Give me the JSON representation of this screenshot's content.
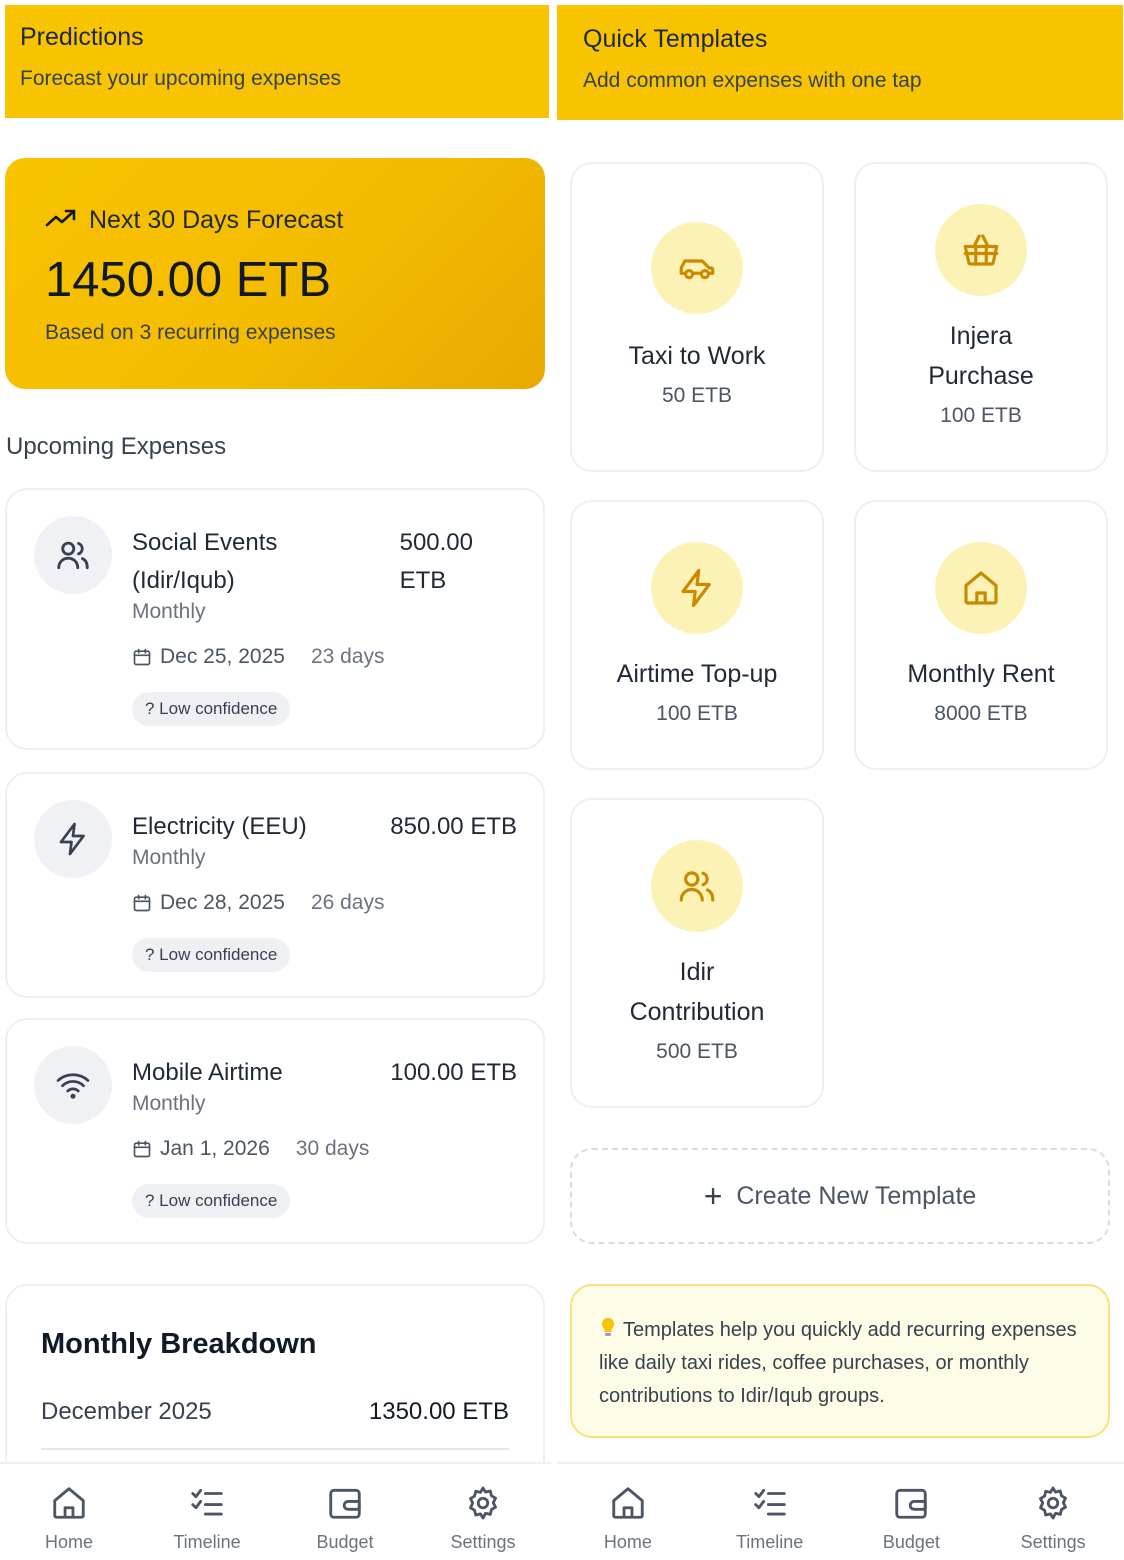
{
  "left": {
    "header": {
      "title": "Predictions",
      "subtitle": "Forecast your upcoming expenses"
    },
    "forecast": {
      "label": "Next 30 Days Forecast",
      "amount": "1450.00 ETB",
      "note": "Based on 3 recurring expenses",
      "icon": "trending-up-icon"
    },
    "upcoming_title": "Upcoming Expenses",
    "expenses": [
      {
        "name_line1": "Social Events",
        "name_line2": "(Idir/Iqub)",
        "amount_line1": "500.00",
        "amount_line2": "ETB",
        "frequency": "Monthly",
        "date": "Dec 25, 2025",
        "days": "23 days",
        "confidence": "? Low confidence",
        "icon": "users-icon"
      },
      {
        "name_line1": "Electricity (EEU)",
        "amount_line1": "850.00 ETB",
        "frequency": "Monthly",
        "date": "Dec 28, 2025",
        "days": "26 days",
        "confidence": "? Low confidence",
        "icon": "zap-icon"
      },
      {
        "name_line1": "Mobile Airtime",
        "amount_line1": "100.00 ETB",
        "frequency": "Monthly",
        "date": "Jan 1, 2026",
        "days": "30 days",
        "confidence": "? Low confidence",
        "icon": "wifi-icon"
      }
    ],
    "breakdown": {
      "title": "Monthly Breakdown",
      "month": "December 2025",
      "value": "1350.00 ETB"
    }
  },
  "right": {
    "header": {
      "title": "Quick Templates",
      "subtitle": "Add common expenses with one tap"
    },
    "templates": [
      {
        "name_line1": "Taxi to Work",
        "amount": "50 ETB",
        "icon": "car-icon"
      },
      {
        "name_line1": "Injera",
        "name_line2": "Purchase",
        "amount": "100 ETB",
        "icon": "basket-icon"
      },
      {
        "name_line1": "Airtime Top-up",
        "amount": "100 ETB",
        "icon": "zap-icon"
      },
      {
        "name_line1": "Monthly Rent",
        "amount": "8000 ETB",
        "icon": "home-icon"
      },
      {
        "name_line1": "Idir",
        "name_line2": "Contribution",
        "amount": "500 ETB",
        "icon": "users-icon"
      }
    ],
    "create_label": "Create New Template",
    "tip": {
      "icon": "lightbulb-icon",
      "text": "Templates help you quickly add recurring expenses like daily taxi rides, coffee purchases, or monthly contributions to Idir/Iqub groups."
    }
  },
  "nav": {
    "items": [
      {
        "label": "Home",
        "icon": "home-icon"
      },
      {
        "label": "Timeline",
        "icon": "list-checks-icon"
      },
      {
        "label": "Budget",
        "icon": "wallet-icon"
      },
      {
        "label": "Settings",
        "icon": "gear-icon"
      }
    ]
  },
  "colors": {
    "accent": "#f8c300",
    "accent_dark": "#e9a800",
    "icon_bg": "#fdf2b6",
    "icon_stroke": "#c98a00",
    "text": "#1f2937",
    "muted": "#6b7280"
  }
}
